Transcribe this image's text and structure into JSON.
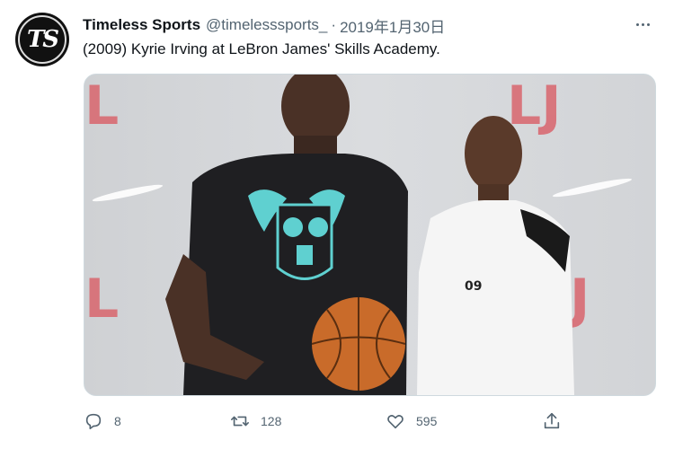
{
  "author": {
    "name": "Timeless Sports",
    "handle": "@timelesssports_",
    "separator": "·",
    "date": "2019年1月30日",
    "avatar_monogram": "TS"
  },
  "tweet": {
    "text": "(2009) Kyrie Irving at LeBron James' Skills Academy."
  },
  "media": {
    "type": "photo",
    "jersey_number": "09"
  },
  "actions": {
    "reply_count": "8",
    "retweet_count": "128",
    "like_count": "595"
  },
  "icons": {
    "reply": "reply-icon",
    "retweet": "retweet-icon",
    "like": "heart-icon",
    "share": "share-icon",
    "more": "more-icon"
  },
  "colors": {
    "text_primary": "#0f1419",
    "text_secondary": "#536471",
    "backdrop_logo": "#d9656d"
  }
}
